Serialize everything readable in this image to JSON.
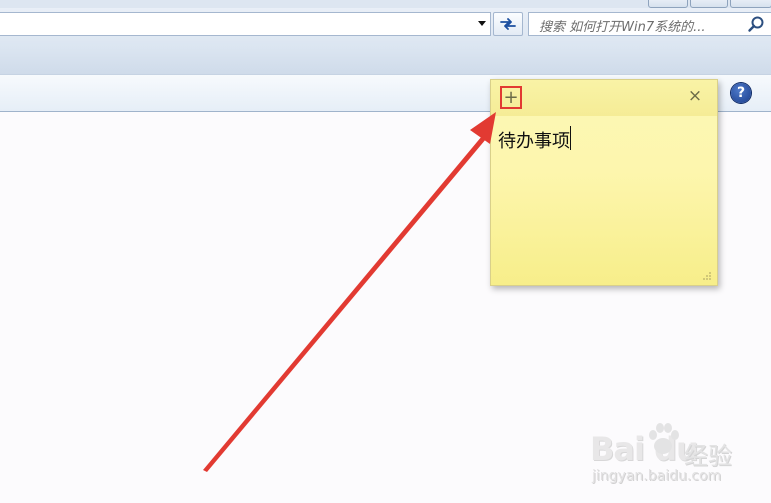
{
  "addressbar": {
    "search_placeholder": "搜索 如何打开Win7系统的..."
  },
  "toolbar": {
    "help_label": "?"
  },
  "sticky_note": {
    "add_label": "+",
    "close_label": "×",
    "text": "待办事项"
  },
  "watermark": {
    "logo": "Bai  du",
    "brand": "经验",
    "url": "jingyan.baidu.com"
  },
  "colors": {
    "highlight": "#e23a32",
    "note_bg": "#fdf6ad"
  },
  "icons": [
    "refresh-icon",
    "search-icon",
    "help-icon",
    "add-note-icon",
    "close-note-icon",
    "resize-grip-icon",
    "baidu-paw-icon"
  ]
}
